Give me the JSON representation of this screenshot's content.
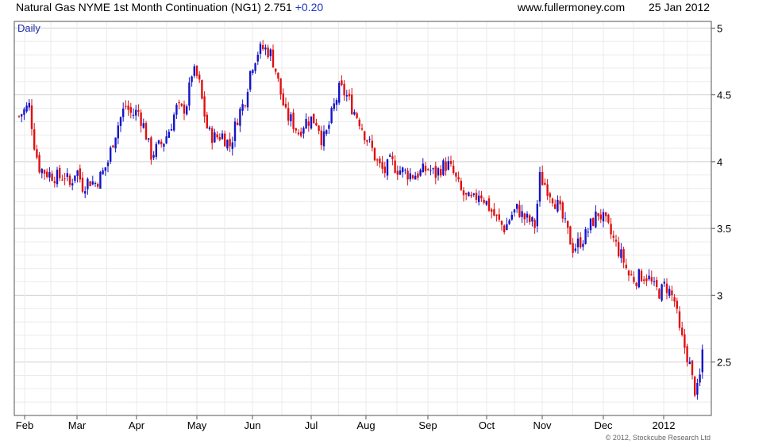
{
  "header": {
    "title": "Natural Gas NYME 1st Month Continuation (NG1) 2.751",
    "change": "+0.20",
    "site": "www.fullermoney.com",
    "date": "25 Jan 2012"
  },
  "chart_data": {
    "type": "candlestick",
    "period_label": "Daily",
    "x_labels": [
      "Feb",
      "Mar",
      "Apr",
      "May",
      "Jun",
      "Jul",
      "Aug",
      "Sep",
      "Oct",
      "Nov",
      "Dec",
      "2012"
    ],
    "y_ticks": [
      2.5,
      3,
      3.5,
      4,
      4.5,
      5
    ],
    "ylim": [
      2.1,
      5.05
    ],
    "grid": true,
    "up_color": "#1515c8",
    "down_color": "#e01010",
    "approx_closes": [
      {
        "month": "Feb",
        "close": 4.35
      },
      {
        "month": "Mar",
        "close": 3.85
      },
      {
        "month": "Apr",
        "close": 4.3
      },
      {
        "month": "May",
        "close": 4.6
      },
      {
        "month": "Jun",
        "close": 4.6
      },
      {
        "month": "Jul",
        "close": 4.3
      },
      {
        "month": "Aug",
        "close": 4.1
      },
      {
        "month": "Sep",
        "close": 3.95
      },
      {
        "month": "Oct",
        "close": 3.6
      },
      {
        "month": "Nov",
        "close": 3.7
      },
      {
        "month": "Dec",
        "close": 3.3
      },
      {
        "month": "2012",
        "close": 3.0
      },
      {
        "month": "25 Jan 2012",
        "close": 2.751
      }
    ],
    "copyright": "© 2012, Stockcube Research Ltd"
  }
}
